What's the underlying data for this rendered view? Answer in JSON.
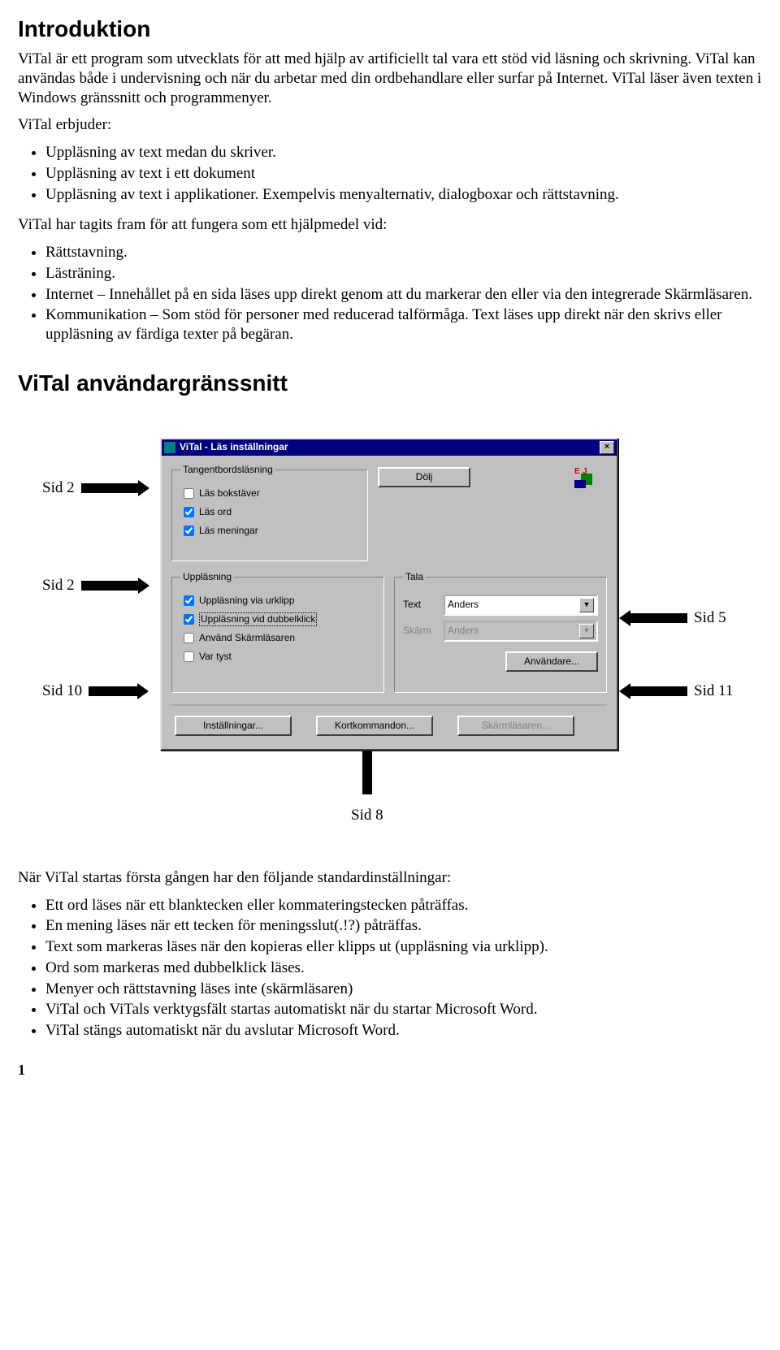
{
  "h1": "Introduktion",
  "p1": "ViTal är ett program som utvecklats för att med hjälp av artificiellt tal vara ett stöd vid läsning och skrivning. ViTal kan användas både i undervisning och när du arbetar med din ordbehandlare eller surfar på Internet. ViTal läser även texten i Windows gränssnitt och programmenyer.",
  "p2_lead": "ViTal erbjuder:",
  "list1": [
    "Uppläsning av text medan du skriver.",
    "Uppläsning av text i ett dokument",
    "Uppläsning av text i applikationer. Exempelvis menyalternativ, dialogboxar och rättstavning."
  ],
  "p3_lead": "ViTal har tagits fram för att fungera som ett hjälpmedel vid:",
  "list2": [
    "Rättstavning.",
    "Lästräning.",
    "Internet – Innehållet på en sida läses upp direkt genom att du markerar den eller via den integrerade Skärmläsaren.",
    "Kommunikation – Som stöd för personer med reducerad talförmåga. Text läses upp direkt när den skrivs eller uppläsning av färdiga texter på begäran."
  ],
  "h2": "ViTal användargränssnitt",
  "dialog": {
    "title": "ViTal - Läs inställningar",
    "close": "×",
    "grp_tang": {
      "legend": "Tangentbordsläsning",
      "items": [
        {
          "label": "Läs bokstäver",
          "checked": false
        },
        {
          "label": "Läs ord",
          "checked": true
        },
        {
          "label": "Läs meningar",
          "checked": true
        }
      ]
    },
    "btn_dolj": "Dölj",
    "grp_upp": {
      "legend": "Uppläsning",
      "items": [
        {
          "label": "Uppläsning via urklipp",
          "checked": true
        },
        {
          "label": "Uppläsning vid dubbelklick",
          "checked": true
        },
        {
          "label": "Använd Skärmläsaren",
          "checked": false
        },
        {
          "label": "Var tyst",
          "checked": false
        }
      ]
    },
    "grp_tala": {
      "legend": "Tala",
      "row_text": {
        "label": "Text",
        "value": "Anders"
      },
      "row_skarm": {
        "label": "Skärm",
        "value": "Anders"
      },
      "btn_user": "Användare..."
    },
    "btn_install": "Inställningar...",
    "btn_kort": "Kortkommandon...",
    "btn_skarm": "Skärmläsaren..."
  },
  "callouts": {
    "c1": "Sid 2",
    "c2": "Sid 2",
    "c3": "Sid 5",
    "c4": "Sid 10",
    "c5": "Sid 11",
    "c6": "Sid 8"
  },
  "p5_lead": "När ViTal startas första gången har den följande standardinställningar:",
  "list3": [
    "Ett ord läses när ett blanktecken eller kommateringstecken påträffas.",
    "En mening läses när ett tecken för meningsslut(.!?) påträffas.",
    "Text som markeras läses när den kopieras eller klipps ut (uppläsning via urklipp).",
    "Ord som markeras med dubbelklick läses.",
    "Menyer och rättstavning läses inte (skärmläsaren)",
    "ViTal och ViTals verktygsfält startas automatiskt när du startar Microsoft Word.",
    "ViTal stängs automatiskt när du avslutar Microsoft Word."
  ],
  "pagenum": "1"
}
